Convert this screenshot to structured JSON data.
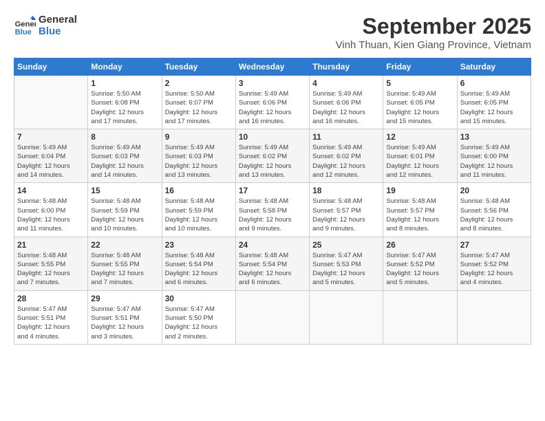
{
  "header": {
    "logo_line1": "General",
    "logo_line2": "Blue",
    "month": "September 2025",
    "location": "Vinh Thuan, Kien Giang Province, Vietnam"
  },
  "weekdays": [
    "Sunday",
    "Monday",
    "Tuesday",
    "Wednesday",
    "Thursday",
    "Friday",
    "Saturday"
  ],
  "weeks": [
    [
      {
        "day": "",
        "info": ""
      },
      {
        "day": "1",
        "info": "Sunrise: 5:50 AM\nSunset: 6:08 PM\nDaylight: 12 hours\nand 17 minutes."
      },
      {
        "day": "2",
        "info": "Sunrise: 5:50 AM\nSunset: 6:07 PM\nDaylight: 12 hours\nand 17 minutes."
      },
      {
        "day": "3",
        "info": "Sunrise: 5:49 AM\nSunset: 6:06 PM\nDaylight: 12 hours\nand 16 minutes."
      },
      {
        "day": "4",
        "info": "Sunrise: 5:49 AM\nSunset: 6:06 PM\nDaylight: 12 hours\nand 16 minutes."
      },
      {
        "day": "5",
        "info": "Sunrise: 5:49 AM\nSunset: 6:05 PM\nDaylight: 12 hours\nand 15 minutes."
      },
      {
        "day": "6",
        "info": "Sunrise: 5:49 AM\nSunset: 6:05 PM\nDaylight: 12 hours\nand 15 minutes."
      }
    ],
    [
      {
        "day": "7",
        "info": "Sunrise: 5:49 AM\nSunset: 6:04 PM\nDaylight: 12 hours\nand 14 minutes."
      },
      {
        "day": "8",
        "info": "Sunrise: 5:49 AM\nSunset: 6:03 PM\nDaylight: 12 hours\nand 14 minutes."
      },
      {
        "day": "9",
        "info": "Sunrise: 5:49 AM\nSunset: 6:03 PM\nDaylight: 12 hours\nand 13 minutes."
      },
      {
        "day": "10",
        "info": "Sunrise: 5:49 AM\nSunset: 6:02 PM\nDaylight: 12 hours\nand 13 minutes."
      },
      {
        "day": "11",
        "info": "Sunrise: 5:49 AM\nSunset: 6:02 PM\nDaylight: 12 hours\nand 12 minutes."
      },
      {
        "day": "12",
        "info": "Sunrise: 5:49 AM\nSunset: 6:01 PM\nDaylight: 12 hours\nand 12 minutes."
      },
      {
        "day": "13",
        "info": "Sunrise: 5:49 AM\nSunset: 6:00 PM\nDaylight: 12 hours\nand 11 minutes."
      }
    ],
    [
      {
        "day": "14",
        "info": "Sunrise: 5:48 AM\nSunset: 6:00 PM\nDaylight: 12 hours\nand 11 minutes."
      },
      {
        "day": "15",
        "info": "Sunrise: 5:48 AM\nSunset: 5:59 PM\nDaylight: 12 hours\nand 10 minutes."
      },
      {
        "day": "16",
        "info": "Sunrise: 5:48 AM\nSunset: 5:59 PM\nDaylight: 12 hours\nand 10 minutes."
      },
      {
        "day": "17",
        "info": "Sunrise: 5:48 AM\nSunset: 5:58 PM\nDaylight: 12 hours\nand 9 minutes."
      },
      {
        "day": "18",
        "info": "Sunrise: 5:48 AM\nSunset: 5:57 PM\nDaylight: 12 hours\nand 9 minutes."
      },
      {
        "day": "19",
        "info": "Sunrise: 5:48 AM\nSunset: 5:57 PM\nDaylight: 12 hours\nand 8 minutes."
      },
      {
        "day": "20",
        "info": "Sunrise: 5:48 AM\nSunset: 5:56 PM\nDaylight: 12 hours\nand 8 minutes."
      }
    ],
    [
      {
        "day": "21",
        "info": "Sunrise: 5:48 AM\nSunset: 5:55 PM\nDaylight: 12 hours\nand 7 minutes."
      },
      {
        "day": "22",
        "info": "Sunrise: 5:48 AM\nSunset: 5:55 PM\nDaylight: 12 hours\nand 7 minutes."
      },
      {
        "day": "23",
        "info": "Sunrise: 5:48 AM\nSunset: 5:54 PM\nDaylight: 12 hours\nand 6 minutes."
      },
      {
        "day": "24",
        "info": "Sunrise: 5:48 AM\nSunset: 5:54 PM\nDaylight: 12 hours\nand 6 minutes."
      },
      {
        "day": "25",
        "info": "Sunrise: 5:47 AM\nSunset: 5:53 PM\nDaylight: 12 hours\nand 5 minutes."
      },
      {
        "day": "26",
        "info": "Sunrise: 5:47 AM\nSunset: 5:52 PM\nDaylight: 12 hours\nand 5 minutes."
      },
      {
        "day": "27",
        "info": "Sunrise: 5:47 AM\nSunset: 5:52 PM\nDaylight: 12 hours\nand 4 minutes."
      }
    ],
    [
      {
        "day": "28",
        "info": "Sunrise: 5:47 AM\nSunset: 5:51 PM\nDaylight: 12 hours\nand 4 minutes."
      },
      {
        "day": "29",
        "info": "Sunrise: 5:47 AM\nSunset: 5:51 PM\nDaylight: 12 hours\nand 3 minutes."
      },
      {
        "day": "30",
        "info": "Sunrise: 5:47 AM\nSunset: 5:50 PM\nDaylight: 12 hours\nand 2 minutes."
      },
      {
        "day": "",
        "info": ""
      },
      {
        "day": "",
        "info": ""
      },
      {
        "day": "",
        "info": ""
      },
      {
        "day": "",
        "info": ""
      }
    ]
  ]
}
